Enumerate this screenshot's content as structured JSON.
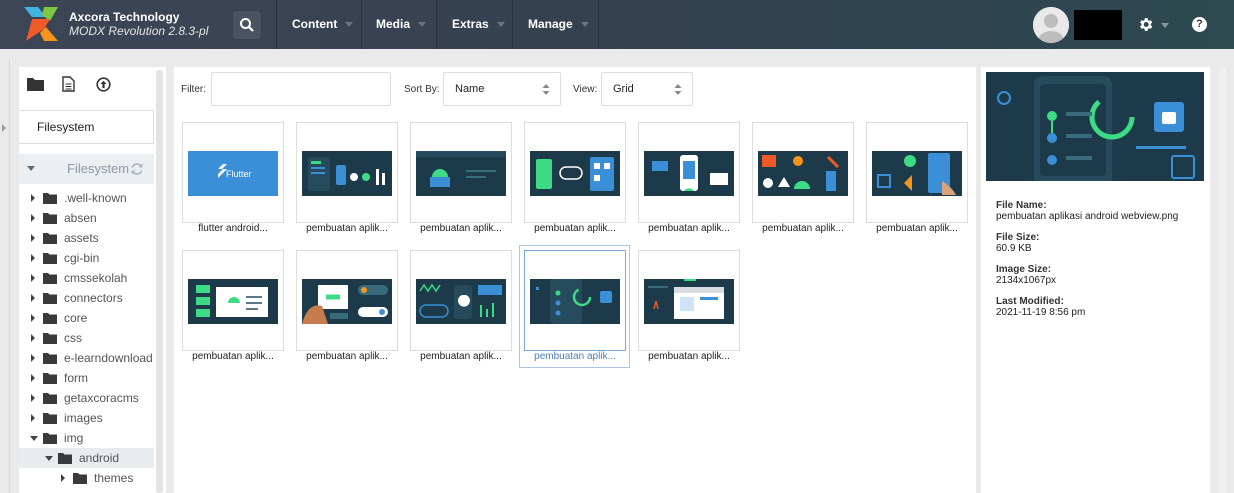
{
  "header": {
    "brand_name": "Axcora Technology",
    "brand_version": "MODX Revolution 2.8.3-pl",
    "nav": [
      "Content",
      "Media",
      "Extras",
      "Manage"
    ],
    "icons": [
      "search-icon",
      "gear-icon",
      "help-icon"
    ],
    "help_glyph": "?"
  },
  "sidebar": {
    "tool_icons": [
      "folder-icon",
      "new-file-icon",
      "upload-icon"
    ],
    "source_field": "Filesystem",
    "tree_root": "Filesystem",
    "tree": [
      {
        "label": ".well-known",
        "expanded": false
      },
      {
        "label": "absen",
        "expanded": false
      },
      {
        "label": "assets",
        "expanded": false
      },
      {
        "label": "cgi-bin",
        "expanded": false
      },
      {
        "label": "cmssekolah",
        "expanded": false
      },
      {
        "label": "connectors",
        "expanded": false
      },
      {
        "label": "core",
        "expanded": false
      },
      {
        "label": "css",
        "expanded": false
      },
      {
        "label": "e-learndownload",
        "expanded": false
      },
      {
        "label": "form",
        "expanded": false
      },
      {
        "label": "getaxcoracms",
        "expanded": false
      },
      {
        "label": "images",
        "expanded": false
      },
      {
        "label": "img",
        "expanded": true
      },
      {
        "label": "android",
        "expanded": true,
        "active": true
      },
      {
        "label": "themes",
        "expanded": false
      }
    ]
  },
  "toolbar": {
    "filter_label": "Filter:",
    "filter_value": "",
    "sort_label": "Sort By:",
    "sort_value": "Name",
    "view_label": "View:",
    "view_value": "Grid"
  },
  "files": [
    {
      "caption": "flutter android...",
      "preview_text": "Flutter"
    },
    {
      "caption": "pembuatan aplik..."
    },
    {
      "caption": "pembuatan aplik..."
    },
    {
      "caption": "pembuatan aplik..."
    },
    {
      "caption": "pembuatan aplik..."
    },
    {
      "caption": "pembuatan aplik..."
    },
    {
      "caption": "pembuatan aplik..."
    },
    {
      "caption": "pembuatan aplik..."
    },
    {
      "caption": "pembuatan aplik..."
    },
    {
      "caption": "pembuatan aplik..."
    },
    {
      "caption": "pembuatan aplik...",
      "selected": true
    },
    {
      "caption": "pembuatan aplik..."
    }
  ],
  "details": {
    "file_name_label": "File Name:",
    "file_name": "pembuatan aplikasi android webview.png",
    "file_size_label": "File Size:",
    "file_size": "60.9 KB",
    "image_size_label": "Image Size:",
    "image_size": "2134x1067px",
    "modified_label": "Last Modified:",
    "modified": "2021-11-19 8:56 pm"
  },
  "colors": {
    "accent_blue": "#4a7fb5",
    "thumb_bg": "#1d3a4a",
    "android_green": "#3ddc84",
    "flutter_blue": "#3a8fd6"
  }
}
